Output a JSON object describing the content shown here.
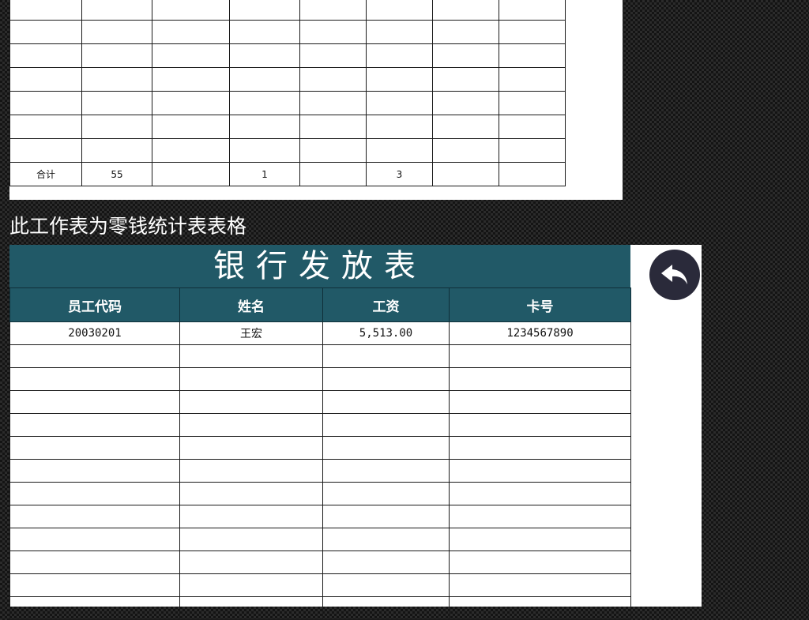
{
  "change_sheet": {
    "rows": [
      [
        "",
        "",
        "",
        "",
        "",
        "",
        "",
        ""
      ],
      [
        "",
        "",
        "",
        "",
        "",
        "",
        "",
        ""
      ],
      [
        "",
        "",
        "",
        "",
        "",
        "",
        "",
        ""
      ],
      [
        "",
        "",
        "",
        "",
        "",
        "",
        "",
        ""
      ],
      [
        "",
        "",
        "",
        "",
        "",
        "",
        "",
        ""
      ],
      [
        "",
        "",
        "",
        "",
        "",
        "",
        "",
        ""
      ],
      [
        "",
        "",
        "",
        "",
        "",
        "",
        "",
        ""
      ],
      [
        "合计",
        "55",
        "",
        "1",
        "",
        "3",
        "",
        ""
      ]
    ]
  },
  "caption": "此工作表为零钱统计表表格",
  "bank_sheet": {
    "title": "银行发放表",
    "headers": [
      "员工代码",
      "姓名",
      "工资",
      "卡号"
    ],
    "rows": [
      [
        "20030201",
        "王宏",
        "5,513.00",
        "1234567890"
      ],
      [
        "",
        "",
        "",
        ""
      ],
      [
        "",
        "",
        "",
        ""
      ],
      [
        "",
        "",
        "",
        ""
      ],
      [
        "",
        "",
        "",
        ""
      ],
      [
        "",
        "",
        "",
        ""
      ],
      [
        "",
        "",
        "",
        ""
      ],
      [
        "",
        "",
        "",
        ""
      ],
      [
        "",
        "",
        "",
        ""
      ],
      [
        "",
        "",
        "",
        ""
      ],
      [
        "",
        "",
        "",
        ""
      ],
      [
        "",
        "",
        "",
        ""
      ],
      [
        "",
        "",
        "",
        ""
      ]
    ]
  },
  "back_button_icon": "back-arrow-icon",
  "colors": {
    "header_bg": "#215967",
    "header_text": "#ffffff",
    "back_button_bg": "#2a2a3a"
  }
}
